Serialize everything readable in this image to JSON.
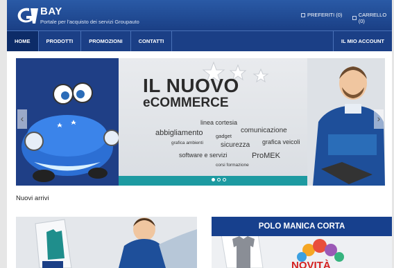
{
  "header": {
    "brand": "BAY",
    "tagline": "Portale per l'acquisto dei servizi Groupauto",
    "favorites_label": "PREFERITI (0)",
    "cart_label": "CARRELLO (0)"
  },
  "nav": {
    "items": [
      "HOME",
      "PRODOTTI",
      "PROMOZIONI",
      "CONTATTI"
    ],
    "account": "IL MIO ACCOUNT"
  },
  "banner": {
    "title": "IL NUOVO",
    "subtitle": "eCOMMERCE",
    "words": [
      "linea cortesia",
      "abbigliamento",
      "gadget",
      "comunicazione",
      "grafica ambienti",
      "sicurezza",
      "grafica veicoli",
      "software e servizi",
      "ProMEK",
      "corsi formazione"
    ],
    "active_slide": 1,
    "slide_count": 3
  },
  "section": {
    "title": "Nuovi arrivi"
  },
  "cards": {
    "card2_title": "POLO MANICA CORTA",
    "card2_badge": "NOVITÀ"
  },
  "colors": {
    "header": "#1b3f86",
    "accent": "#1d9aa1",
    "badge": "#d42020"
  },
  "icons": [
    "heart-icon",
    "cart-icon",
    "chevron-left-icon",
    "chevron-right-icon"
  ]
}
